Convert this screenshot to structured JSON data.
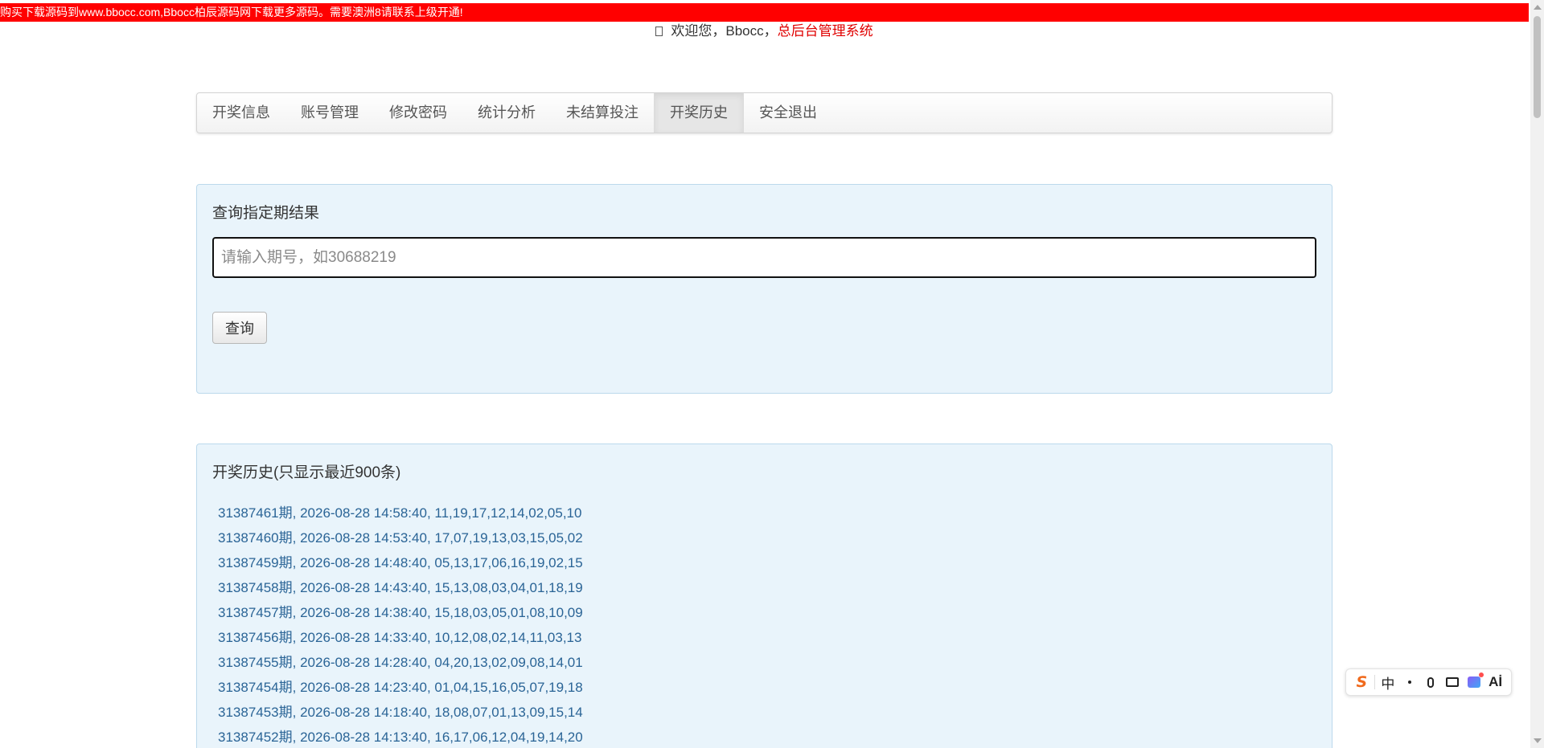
{
  "notice": "购买下载源码到www.bbocc.com,Bbocc柏辰源码网下载更多源码。需要澳洲8请联系上级开通!",
  "welcome": {
    "icon": "user-icon",
    "prefix": "欢迎您，Bbocc，",
    "system_link": "总后台管理系统"
  },
  "nav": {
    "items": [
      {
        "label": "开奖信息"
      },
      {
        "label": "账号管理"
      },
      {
        "label": "修改密码"
      },
      {
        "label": "统计分析"
      },
      {
        "label": "未结算投注"
      },
      {
        "label": "开奖历史"
      },
      {
        "label": "安全退出"
      }
    ],
    "active": "开奖历史"
  },
  "query": {
    "title": "查询指定期结果",
    "placeholder": "请输入期号，如30688219",
    "value": "",
    "button_label": "查询"
  },
  "history": {
    "title": "开奖历史(只显示最近900条)",
    "rows": [
      "31387461期, 2026-08-28 14:58:40, 11,19,17,12,14,02,05,10",
      "31387460期, 2026-08-28 14:53:40, 17,07,19,13,03,15,05,02",
      "31387459期, 2026-08-28 14:48:40, 05,13,17,06,16,19,02,15",
      "31387458期, 2026-08-28 14:43:40, 15,13,08,03,04,01,18,19",
      "31387457期, 2026-08-28 14:38:40, 15,18,03,05,01,08,10,09",
      "31387456期, 2026-08-28 14:33:40, 10,12,08,02,14,11,03,13",
      "31387455期, 2026-08-28 14:28:40, 04,20,13,02,09,08,14,01",
      "31387454期, 2026-08-28 14:23:40, 01,04,15,16,05,07,19,18",
      "31387453期, 2026-08-28 14:18:40, 18,08,07,01,13,09,15,14",
      "31387452期, 2026-08-28 14:13:40, 16,17,06,12,04,19,14,20"
    ]
  },
  "ime": {
    "logo": "S",
    "mode": "中",
    "punct_icon": "punctuation-icon",
    "voice_icon": "microphone-icon",
    "keyboard_icon": "keyboard-icon",
    "skin_icon": "skin-icon",
    "ai_label": "Aİ"
  },
  "colors": {
    "notice_bg": "#ff0000",
    "system_link": "#e00000",
    "panel_bg": "#e9f4fb",
    "history_text": "#2a6496"
  }
}
